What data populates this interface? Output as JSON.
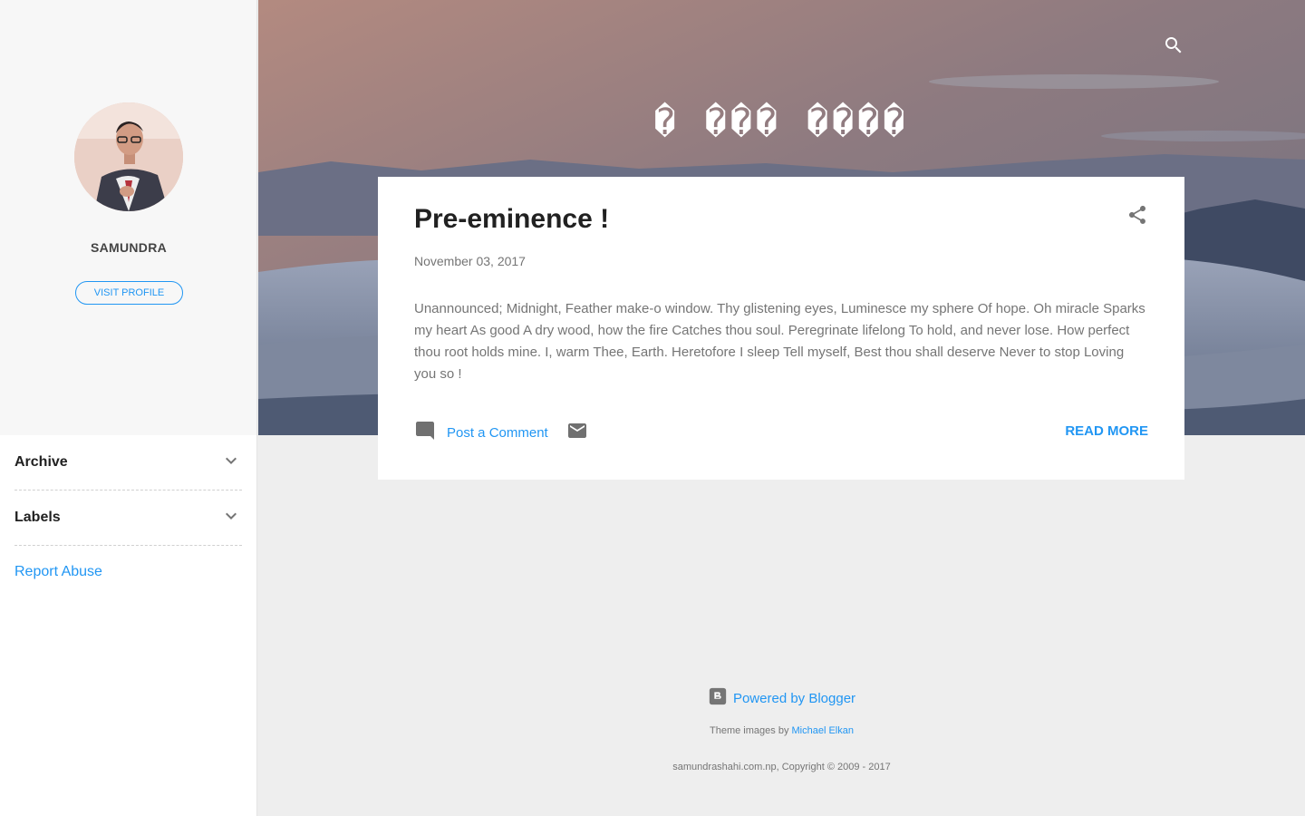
{
  "sidebar": {
    "profile_name": "SAMUNDRA",
    "visit_profile_label": "VISIT PROFILE",
    "widgets": [
      {
        "label": "Archive"
      },
      {
        "label": "Labels"
      }
    ],
    "report_abuse_label": "Report Abuse"
  },
  "header": {
    "blog_title": "� ��� ����"
  },
  "post": {
    "title": "Pre-eminence !",
    "date": "November 03, 2017",
    "body": "Unannounced; Midnight, Feather make-o window. Thy glistening eyes, Luminesce my sphere Of hope. Oh miracle Sparks my heart As good A dry wood, how the fire Catches thou soul. Peregrinate lifelong To hold, and never lose. How perfect thou root holds mine. I, warm Thee, Earth. Heretofore I sleep Tell myself, Best thou shall deserve Never to stop Loving you so !",
    "comment_label": "Post a Comment",
    "read_more_label": "Read more"
  },
  "footer": {
    "powered_by_label": "Powered by Blogger",
    "theme_prefix": "Theme images by ",
    "theme_author": "Michael Elkan",
    "copyright": "samundrashahi.com.np, Copyright © 2009 - 2017"
  },
  "icons": {
    "search": "search-icon",
    "share": "share-icon",
    "comment": "comment-icon",
    "email": "email-icon",
    "expand": "chevron-down-icon",
    "blogger": "blogger-icon"
  },
  "colors": {
    "accent": "#2196f3",
    "title_text": "#212121",
    "body_text": "#757575",
    "page_bg": "#eeeeee",
    "sidebar_bg": "#f7f7f7"
  }
}
